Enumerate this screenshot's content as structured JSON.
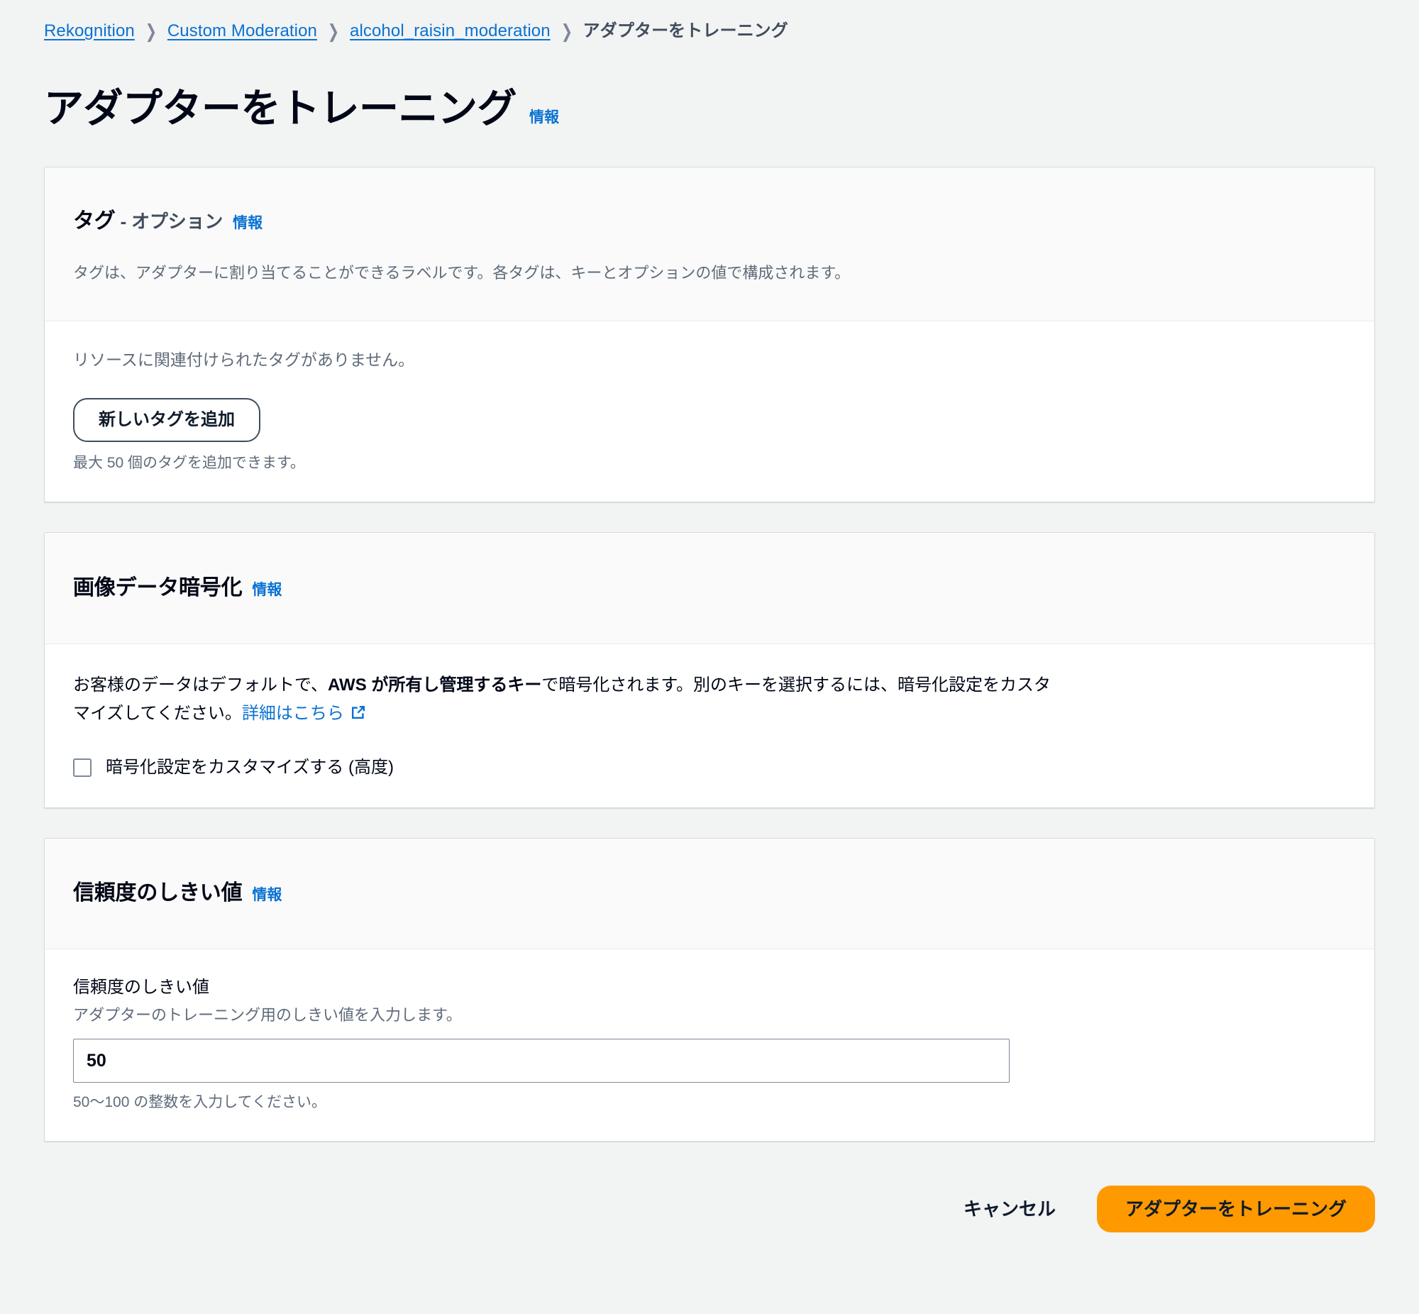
{
  "breadcrumb": {
    "items": [
      {
        "label": "Rekognition",
        "type": "link"
      },
      {
        "label": "Custom Moderation",
        "type": "link"
      },
      {
        "label": "alcohol_raisin_moderation",
        "type": "link"
      },
      {
        "label": "アダプターをトレーニング",
        "type": "current"
      }
    ],
    "separator": "❯"
  },
  "header": {
    "title": "アダプターをトレーニング",
    "info_label": "情報"
  },
  "tags_section": {
    "title_main": "タグ",
    "title_sub": " - オプション",
    "info_label": "情報",
    "description": "タグは、アダプターに割り当てることができるラベルです。各タグは、キーとオプションの値で構成されます。",
    "empty_message": "リソースに関連付けられたタグがありません。",
    "add_button_label": "新しいタグを追加",
    "limit_hint": "最大 50 個のタグを追加できます。"
  },
  "encryption_section": {
    "title": "画像データ暗号化",
    "info_label": "情報",
    "body_part1": "お客様のデータはデフォルトで、",
    "body_bold": "AWS が所有し管理するキー",
    "body_part2": "で暗号化されます。別のキーを選択するには、暗号化設定をカスタマイズしてください。",
    "learn_more_label": "詳細はこちら",
    "external_icon": "external-link-icon",
    "checkbox_label": "暗号化設定をカスタマイズする (高度)",
    "checkbox_checked": false
  },
  "threshold_section": {
    "title": "信頼度のしきい値",
    "info_label": "情報",
    "field_label": "信頼度のしきい値",
    "field_description": "アダプターのトレーニング用のしきい値を入力します。",
    "field_value": "50",
    "field_placeholder": "",
    "field_hint": "50〜100 の整数を入力してください。"
  },
  "footer": {
    "cancel_label": "キャンセル",
    "submit_label": "アダプターをトレーニング"
  },
  "colors": {
    "page_background": "#f2f3f3",
    "card_background": "#ffffff",
    "card_header_background": "#fafafa",
    "link_blue": "#0972d3",
    "primary_orange": "#ff9900",
    "text_primary": "#000716",
    "text_secondary": "#5f6b7a",
    "border": "#d5dbdb"
  }
}
